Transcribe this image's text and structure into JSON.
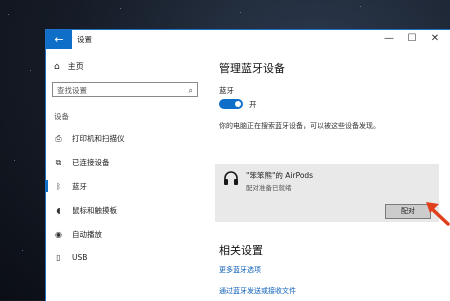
{
  "window": {
    "title": "设置",
    "back_icon": "arrow-left-icon",
    "controls": [
      "—",
      "☐",
      "✕"
    ]
  },
  "sidebar": {
    "home_label": "主页",
    "search_placeholder": "查找设置",
    "section_label": "设备",
    "items": [
      {
        "label": "打印机和扫描仪",
        "icon": "printer-icon"
      },
      {
        "label": "已连接设备",
        "icon": "connected-devices-icon"
      },
      {
        "label": "蓝牙",
        "icon": "bluetooth-icon",
        "selected": true
      },
      {
        "label": "鼠标和触摸板",
        "icon": "mouse-icon"
      },
      {
        "label": "自动播放",
        "icon": "autoplay-icon"
      },
      {
        "label": "USB",
        "icon": "usb-icon"
      }
    ]
  },
  "main": {
    "title": "管理蓝牙设备",
    "bluetooth_label": "蓝牙",
    "toggle_state": "开",
    "discover_text": "你的电脑正在搜索蓝牙设备，可以被这些设备发现。",
    "device": {
      "name": "\"笨笨熊\"的 AirPods",
      "status": "配对准备已就绪",
      "icon": "headphones-icon",
      "pair_label": "配对"
    },
    "related_title": "相关设置",
    "links": [
      "更多蓝牙选项",
      "通过蓝牙发送或接收文件"
    ]
  },
  "colors": {
    "accent": "#0f6ec7",
    "card_bg": "#e9e9e9",
    "annotation_arrow": "#e0401c"
  }
}
